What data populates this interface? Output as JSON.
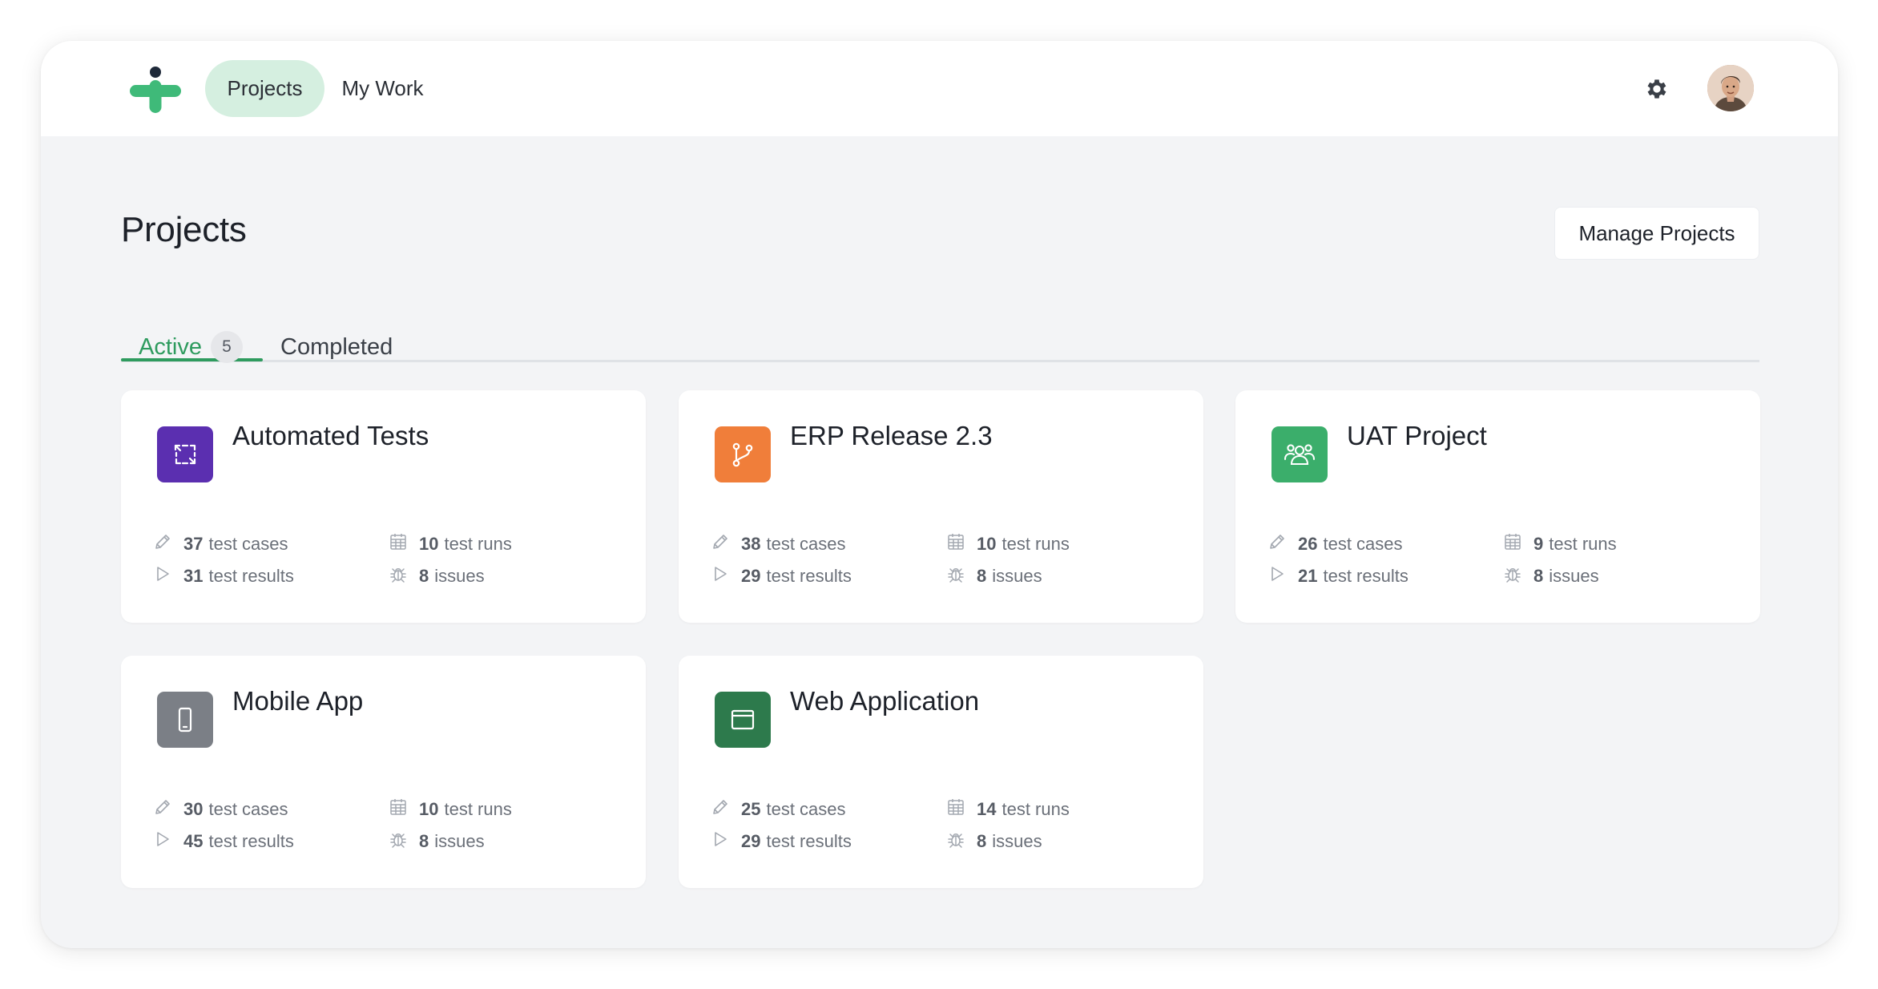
{
  "nav": {
    "items": [
      {
        "label": "Projects",
        "active": true
      },
      {
        "label": "My Work",
        "active": false
      }
    ],
    "icons": {
      "settings": "gear-icon",
      "avatar": "user-avatar"
    }
  },
  "page": {
    "title": "Projects",
    "manage_button": "Manage Projects"
  },
  "tabs": [
    {
      "label": "Active",
      "count": "5",
      "active": true
    },
    {
      "label": "Completed",
      "active": false
    }
  ],
  "stat_labels": {
    "test_cases": "test cases",
    "test_results": "test results",
    "test_runs": "test runs",
    "issues": "issues"
  },
  "projects": [
    {
      "name": "Automated Tests",
      "icon": "sync-arrows-icon",
      "color": "#5b2fb0",
      "test_cases": "37",
      "test_results": "31",
      "test_runs": "10",
      "issues": "8"
    },
    {
      "name": "ERP Release 2.3",
      "icon": "git-branch-icon",
      "color": "#f07e3a",
      "test_cases": "38",
      "test_results": "29",
      "test_runs": "10",
      "issues": "8"
    },
    {
      "name": "UAT Project",
      "icon": "users-icon",
      "color": "#3bae6b",
      "test_cases": "26",
      "test_results": "21",
      "test_runs": "9",
      "issues": "8"
    },
    {
      "name": "Mobile App",
      "icon": "mobile-icon",
      "color": "#7b7f86",
      "test_cases": "30",
      "test_results": "45",
      "test_runs": "10",
      "issues": "8"
    },
    {
      "name": "Web Application",
      "icon": "browser-window-icon",
      "color": "#2d7a4c",
      "test_cases": "25",
      "test_results": "29",
      "test_runs": "14",
      "issues": "8"
    }
  ],
  "colors": {
    "accent": "#2e9b5e",
    "nav_active_bg": "#d5efe0",
    "page_bg": "#f3f4f6"
  }
}
